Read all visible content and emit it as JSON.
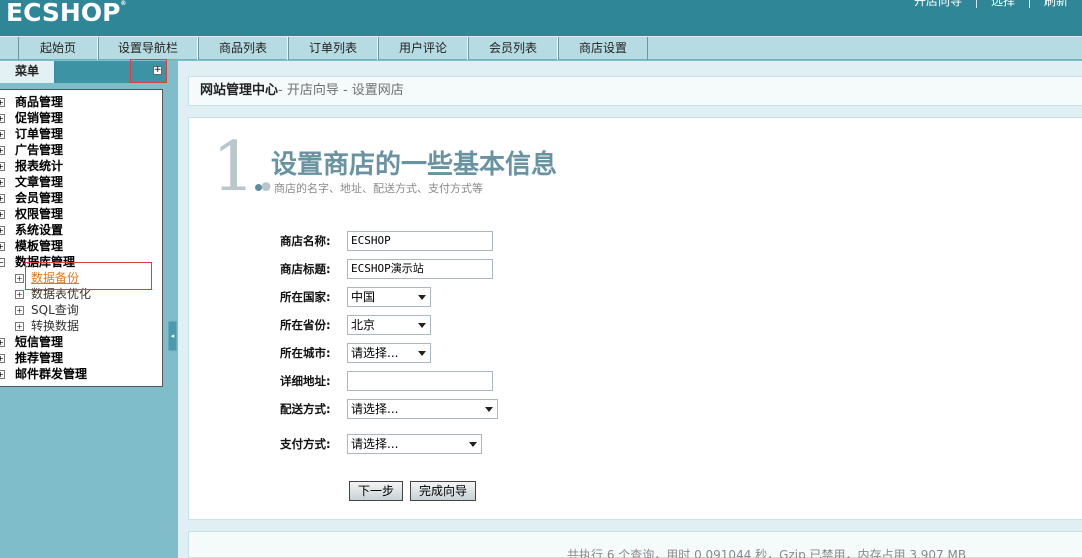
{
  "header": {
    "logo": "ECSHOP",
    "top_links": [
      "开店向导",
      "选择",
      "刷新"
    ]
  },
  "nav": {
    "tabs": [
      "起始页",
      "设置导航栏",
      "商品列表",
      "订单列表",
      "用户评论",
      "会员列表",
      "商店设置"
    ]
  },
  "sidebar": {
    "title": "菜单",
    "expand_symbol": "+",
    "items": [
      {
        "label": "商品管理",
        "sign": "+"
      },
      {
        "label": "促销管理",
        "sign": "+"
      },
      {
        "label": "订单管理",
        "sign": "+"
      },
      {
        "label": "广告管理",
        "sign": "+"
      },
      {
        "label": "报表统计",
        "sign": "+"
      },
      {
        "label": "文章管理",
        "sign": "+"
      },
      {
        "label": "会员管理",
        "sign": "+"
      },
      {
        "label": "权限管理",
        "sign": "+"
      },
      {
        "label": "系统设置",
        "sign": "+"
      },
      {
        "label": "模板管理",
        "sign": "+"
      },
      {
        "label": "数据库管理",
        "sign": "−"
      },
      {
        "label": "数据备份",
        "sign": "+",
        "sub": true,
        "active": true
      },
      {
        "label": "数据表优化",
        "sign": "+",
        "sub": true
      },
      {
        "label": "SQL查询",
        "sign": "+",
        "sub": true
      },
      {
        "label": "转换数据",
        "sign": "+",
        "sub": true
      },
      {
        "label": "短信管理",
        "sign": "+"
      },
      {
        "label": "推荐管理",
        "sign": "+"
      },
      {
        "label": "邮件群发管理",
        "sign": "+"
      }
    ],
    "collapse_symbol": "◂"
  },
  "breadcrumb": {
    "root": "网站管理中心",
    "trail": "- 开店向导 - 设置网店"
  },
  "step": {
    "number": "1.",
    "title": "设置商店的一些基本信息",
    "subtitle": "商店的名字、地址、配送方式、支付方式等"
  },
  "form": {
    "shop_name": {
      "label": "商店名称:",
      "value": "ECSHOP"
    },
    "shop_title": {
      "label": "商店标题:",
      "value": "ECSHOP演示站"
    },
    "country": {
      "label": "所在国家:",
      "value": "中国"
    },
    "province": {
      "label": "所在省份:",
      "value": "北京"
    },
    "city": {
      "label": "所在城市:",
      "value": "请选择..."
    },
    "address": {
      "label": "详细地址:",
      "value": ""
    },
    "shipping": {
      "label": "配送方式:",
      "value": "请选择..."
    },
    "payment": {
      "label": "支付方式:",
      "value": "请选择..."
    }
  },
  "buttons": {
    "next": "下一步",
    "finish": "完成向导"
  },
  "footer": {
    "text": "共执行 6 个查询，用时 0.091044 秒，Gzip 已禁用，内存占用 3.907 MB"
  }
}
